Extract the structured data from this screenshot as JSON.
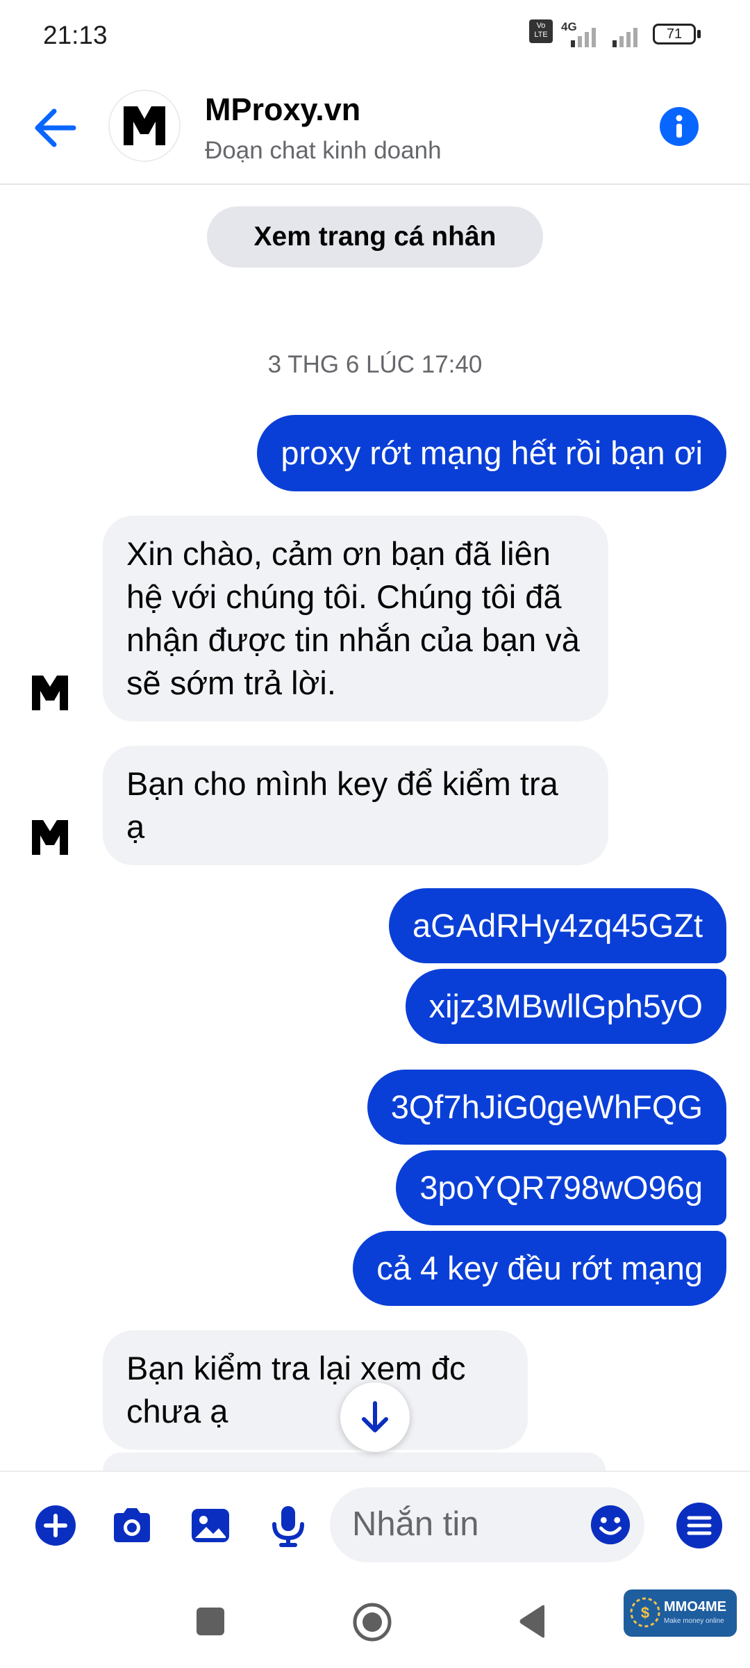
{
  "status_bar": {
    "time": "21:13",
    "network_badge": "Vo LTE",
    "network_type": "4G",
    "battery": "71"
  },
  "header": {
    "page_name": "MProxy.vn",
    "subtitle": "Đoạn chat kinh doanh",
    "avatar_letter": "M"
  },
  "chat": {
    "profile_button": "Xem trang cá nhân",
    "timestamp": "3 THG 6 LÚC 17:40",
    "messages": [
      {
        "from": "me",
        "text": "proxy rớt mạng hết rồi bạn ơi"
      },
      {
        "from": "page",
        "text": "Xin chào, cảm ơn bạn đã liên hệ với chúng tôi. Chúng tôi đã nhận được tin nhắn của bạn và sẽ sớm trả lời."
      },
      {
        "from": "page",
        "text": "Bạn cho mình key để kiểm tra ạ"
      },
      {
        "from": "me",
        "text": "aGAdRHy4zq45GZt"
      },
      {
        "from": "me",
        "text": "xijz3MBwllGph5yO"
      },
      {
        "from": "me",
        "text": "3Qf7hJiG0geWhFQG"
      },
      {
        "from": "me",
        "text": "3poYQR798wO96g"
      },
      {
        "from": "me",
        "text": "cả 4 key đều rớt mạng"
      },
      {
        "from": "page",
        "text": "Bạn kiểm tra lại xem đc chưa ạ"
      }
    ]
  },
  "composer": {
    "placeholder": "Nhắn tin",
    "tools": [
      "plus-icon",
      "camera-icon",
      "image-icon",
      "microphone-icon"
    ]
  },
  "watermark": {
    "brand": "MMO4ME",
    "tagline": "Make money online"
  },
  "colors": {
    "accent": "#0866ff",
    "outgoing_bubble": "#0a3fd7",
    "incoming_bubble": "#f0f2f5",
    "tool_icons": "#0a2fc0"
  }
}
